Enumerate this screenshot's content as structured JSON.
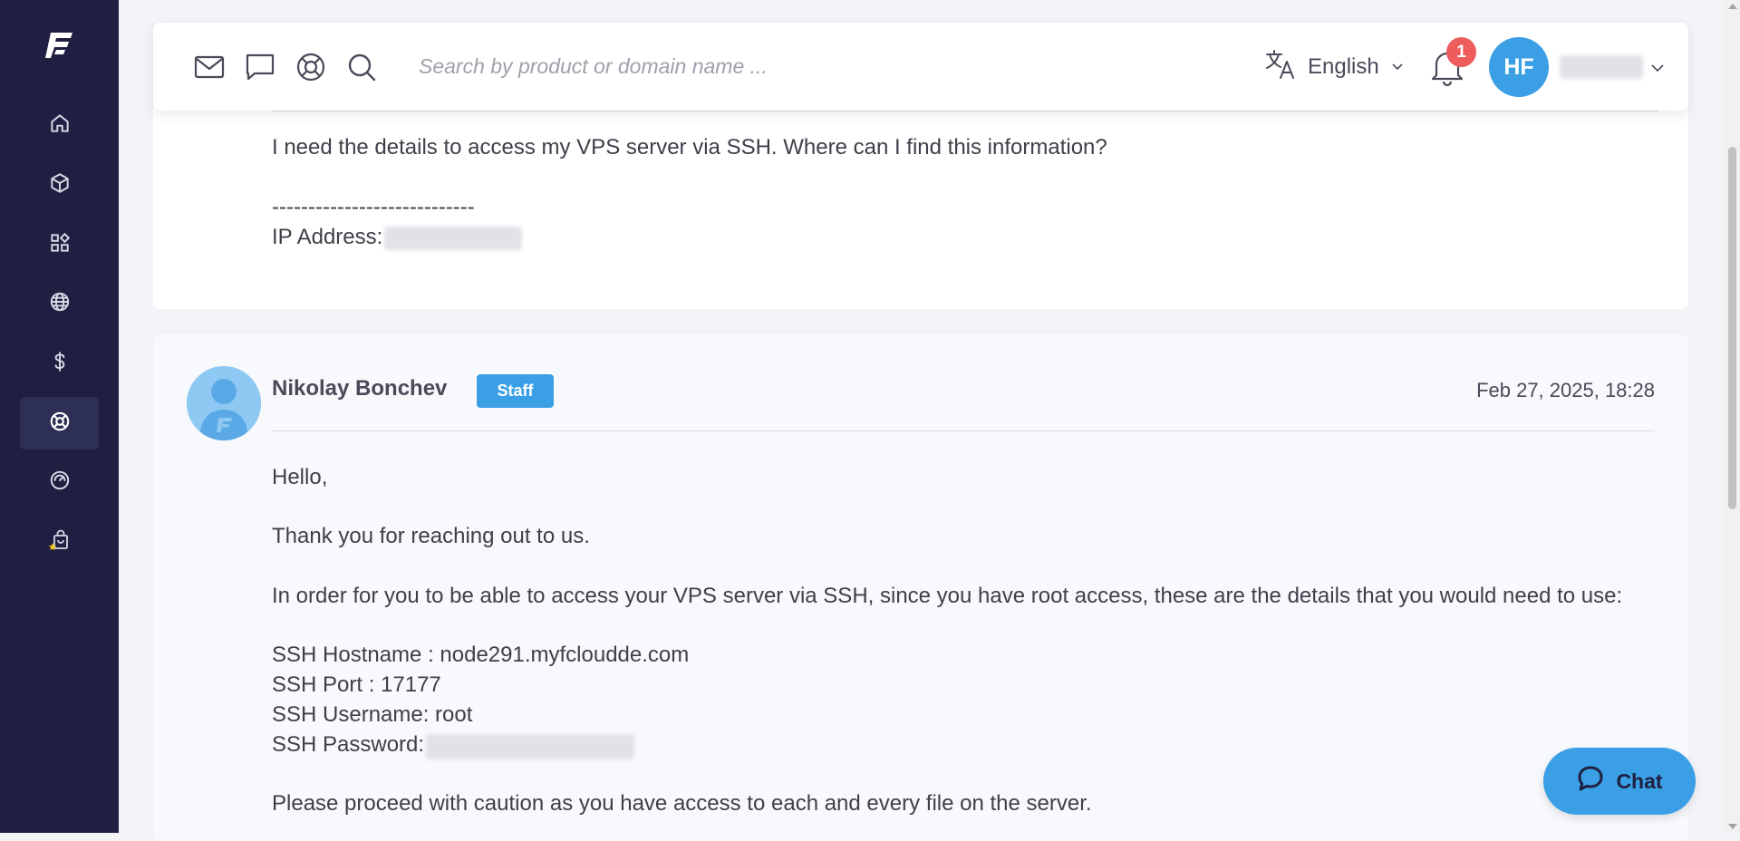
{
  "sidebar": {
    "items": [
      {
        "name": "home-icon"
      },
      {
        "name": "box-icon"
      },
      {
        "name": "apps-icon"
      },
      {
        "name": "globe-icon"
      },
      {
        "name": "dollar-icon"
      },
      {
        "name": "lifebuoy-icon",
        "active": true
      },
      {
        "name": "speedometer-icon"
      },
      {
        "name": "shopping-bag-star-icon"
      }
    ]
  },
  "header": {
    "search_placeholder": "Search by product or domain name ...",
    "language": "English",
    "notifications_count": "1",
    "user_initials": "HF"
  },
  "ticket": {
    "question": "I need the details to access my VPS server via SSH. Where can I find this information?",
    "separator": "----------------------------",
    "ip_label": "IP Address:"
  },
  "reply": {
    "author": "Nikolay Bonchev",
    "role_badge": "Staff",
    "date": "Feb 27, 2025, 18:28",
    "greeting": "Hello,",
    "line1": "Thank you for reaching out to us.",
    "line2": "In order for you to be able to access your VPS server via SSH, since you have root access, these are the details that you would need to use:",
    "ssh_hostname": "SSH Hostname : node291.myfcloudde.com",
    "ssh_port": "SSH Port : 17177",
    "ssh_username": "SSH Username: root",
    "ssh_password_label": "SSH Password:",
    "caution": "Please proceed with caution as you have access to each and every file on the server."
  },
  "chat": {
    "label": "Chat"
  },
  "colors": {
    "sidebar_bg": "#1f2041",
    "accent": "#3a9fe5",
    "badge_red": "#ef5c5c"
  }
}
